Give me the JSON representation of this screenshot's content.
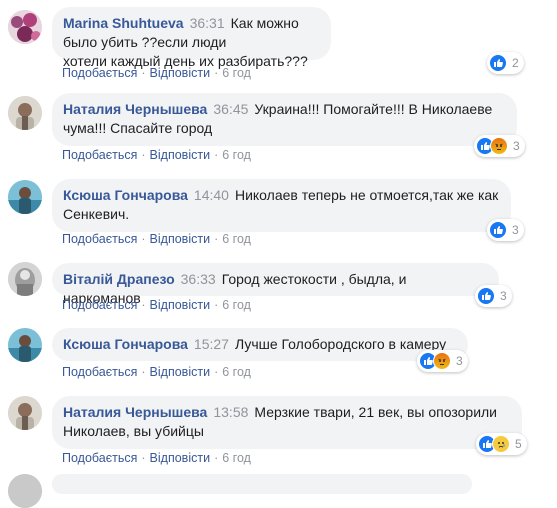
{
  "comments": [
    {
      "author": "Marina Shuhtueva",
      "time": "36:31",
      "text_lines": [
        "Как можно было убить ??если люди",
        "хотели каждый день их разбирать???"
      ],
      "actions": {
        "like": "Подобається",
        "reply": "Відповісти",
        "ago": "6 год"
      },
      "reactions": {
        "icons": [
          "like"
        ],
        "count": "2"
      },
      "avatar_color": "#9b4a7c"
    },
    {
      "author": "Наталия Чернышева",
      "time": "36:45",
      "text_lines": [
        "Украина!!! Помогайте!!! В Николаеве",
        "чума!!! Спасайте город"
      ],
      "actions": {
        "like": "Подобається",
        "reply": "Відповісти",
        "ago": "6 год"
      },
      "reactions": {
        "icons": [
          "like",
          "angry"
        ],
        "count": "3"
      },
      "avatar_color": "#c8c4bc"
    },
    {
      "author": "Ксюша Гончарова",
      "time": "14:40",
      "text_lines": [
        "Николаев теперь не отмоется,так же как",
        "Сенкевич."
      ],
      "actions": {
        "like": "Подобається",
        "reply": "Відповісти",
        "ago": "6 год"
      },
      "reactions": {
        "icons": [
          "like"
        ],
        "count": "3"
      },
      "avatar_color": "#5fa9c4"
    },
    {
      "author": "Віталій Драпезо",
      "time": "36:33",
      "text_lines": [
        "Город жестокости , быдла, и наркоманов"
      ],
      "actions": {
        "like": "Подобається",
        "reply": "Відповісти",
        "ago": "6 год"
      },
      "reactions": {
        "icons": [
          "like"
        ],
        "count": "3"
      },
      "avatar_color": "#b9b9b9"
    },
    {
      "author": "Ксюша Гончарова",
      "time": "15:27",
      "text_lines": [
        "Лучше Голобородского в камеру"
      ],
      "actions": {
        "like": "Подобається",
        "reply": "Відповісти",
        "ago": "6 год"
      },
      "reactions": {
        "icons": [
          "like",
          "angry"
        ],
        "count": "3"
      },
      "avatar_color": "#5fa9c4"
    },
    {
      "author": "Наталия Чернышева",
      "time": "13:58",
      "text_lines": [
        "Мерзкие твари, 21 век, вы опозорили",
        "Николаев, вы убийцы"
      ],
      "actions": {
        "like": "Подобається",
        "reply": "Відповісти",
        "ago": "6 год"
      },
      "reactions": {
        "icons": [
          "like",
          "sad"
        ],
        "count": "5"
      },
      "avatar_color": "#c8c4bc"
    }
  ]
}
